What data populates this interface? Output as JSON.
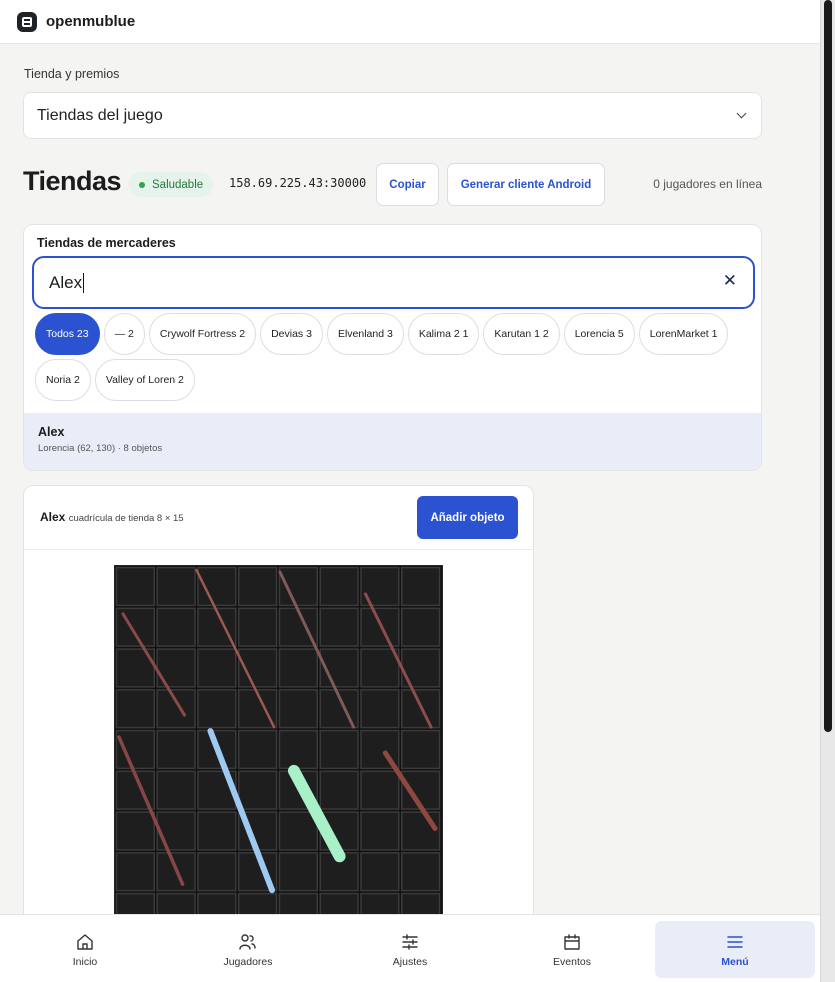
{
  "app": {
    "name": "openmublue"
  },
  "section": {
    "label": "Tienda y premios",
    "selected": "Tiendas del juego"
  },
  "header": {
    "title": "Tiendas",
    "status": "Saludable",
    "address": "158.69.225.43:30000",
    "copy_label": "Copiar",
    "android_label": "Generar cliente Android",
    "players_online": "0 jugadores en línea"
  },
  "merchants": {
    "title": "Tiendas de mercaderes",
    "search_value": "Alex",
    "filters": [
      {
        "label": "Todos 23",
        "active": true
      },
      {
        "label": "— 2",
        "active": false
      },
      {
        "label": "Crywolf Fortress 2",
        "active": false
      },
      {
        "label": "Devias 3",
        "active": false
      },
      {
        "label": "Elvenland 3",
        "active": false
      },
      {
        "label": "Kalima 2 1",
        "active": false
      },
      {
        "label": "Karutan 1 2",
        "active": false
      },
      {
        "label": "Lorencia 5",
        "active": false
      },
      {
        "label": "LorenMarket 1",
        "active": false
      },
      {
        "label": "Noria 2",
        "active": false
      },
      {
        "label": "Valley of Loren 2",
        "active": false
      }
    ],
    "result": {
      "name": "Alex",
      "details": "Lorencia (62, 130) · 8 objetos"
    }
  },
  "shop": {
    "merchant": "Alex",
    "grid_label": "cuadrícula de tienda 8 × 15",
    "add_label": "Añadir objeto",
    "columns": 8,
    "rows": 15,
    "items": [
      {
        "name": "polearm",
        "color": "#8a4a4a"
      },
      {
        "name": "long-spear",
        "color": "#9a5a50"
      },
      {
        "name": "trident",
        "color": "#7e5a58"
      },
      {
        "name": "halberd",
        "color": "#8d4c52"
      },
      {
        "name": "crescent-blade",
        "color": "#87464a"
      },
      {
        "name": "blue-light-staff",
        "color": "#9ec9f0"
      },
      {
        "name": "green-light-rod",
        "color": "#a8f0c8"
      },
      {
        "name": "war-hammer",
        "color": "#8e4840"
      }
    ]
  },
  "nav": [
    {
      "label": "Inicio",
      "icon": "home-icon",
      "active": false
    },
    {
      "label": "Jugadores",
      "icon": "users-icon",
      "active": false
    },
    {
      "label": "Ajustes",
      "icon": "sliders-icon",
      "active": false
    },
    {
      "label": "Eventos",
      "icon": "calendar-icon",
      "active": false
    },
    {
      "label": "Menú",
      "icon": "menu-icon",
      "active": true
    }
  ]
}
